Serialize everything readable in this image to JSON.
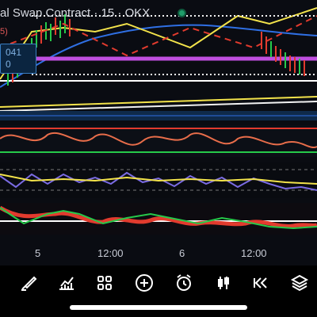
{
  "header": {
    "title": "al Swap Contract · 15 · OKX",
    "price_tag": "041",
    "price_tag_sub": "0",
    "left_fragment": "5)"
  },
  "time_axis": {
    "ticks": [
      "5",
      "12:00",
      "6",
      "12:00"
    ]
  },
  "toolbar": {
    "items": [
      {
        "icon": "brush-icon"
      },
      {
        "icon": "indicators-icon"
      },
      {
        "icon": "layouts-grid-icon"
      },
      {
        "icon": "add-icon"
      },
      {
        "icon": "alarm-icon"
      },
      {
        "icon": "candles-icon"
      },
      {
        "icon": "replay-icon"
      },
      {
        "icon": "layers-icon"
      }
    ]
  },
  "colors": {
    "bg": "#0a0c12",
    "yellow": "#f3e34b",
    "blue": "#2f6fe3",
    "purple": "#c04fe0",
    "red": "#e23b2e",
    "green": "#26c94a",
    "white": "#ffffff"
  }
}
